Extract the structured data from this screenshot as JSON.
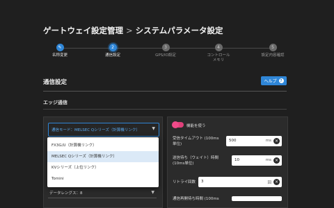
{
  "header": {
    "title_parent": "ゲートウェイ設定管理",
    "separator": ">",
    "title_current": "システムパラメータ設定"
  },
  "stepper": {
    "steps": [
      {
        "label": "名称変更",
        "marker": "✎",
        "state": "done"
      },
      {
        "label": "通信設定",
        "marker": "2",
        "state": "active"
      },
      {
        "label": "GPS/IO設定",
        "marker": "3",
        "state": "todo"
      },
      {
        "label": "コントロール\nメモリ",
        "marker": "4",
        "state": "todo"
      },
      {
        "label": "設定内容確認",
        "marker": "5",
        "state": "todo"
      }
    ]
  },
  "section": {
    "title": "通信設定",
    "help_label": "ヘルプ",
    "help_icon": "?",
    "subsection_title": "エッジ通信"
  },
  "comm_mode": {
    "selected": "通信モード：MELSEC Qシリーズ（計算機リンク）",
    "options": [
      "FX3G/U（計算機リンク）",
      "MELSEC Qシリーズ（計算機リンク）",
      "KVシリーズ（上位リンク）",
      "Tomini"
    ],
    "selected_index": 1
  },
  "data_length": {
    "value": "データレングス：8"
  },
  "function_toggle": {
    "label": "機能を使う",
    "on": true
  },
  "fields": {
    "recv_timeout": {
      "label_line1": "受信タイムアウト (100ms",
      "label_line2": "単位)",
      "value": "500",
      "unit": "ms"
    },
    "send_wait": {
      "label_line1": "送信待ち（ウェイト）時間",
      "label_line2": "(10ms単位)",
      "value": "10",
      "unit": "ms"
    },
    "retry_count": {
      "label_line1": "リトライ回数",
      "value": "3",
      "unit": "回"
    },
    "next_field": {
      "label_line1": "通信再開待ち時間 (100ms"
    }
  },
  "colors": {
    "accent": "#2f86d7",
    "toggle": "#f04b8a",
    "background": "#1f1f1f",
    "panel": "#2b2b2b"
  }
}
